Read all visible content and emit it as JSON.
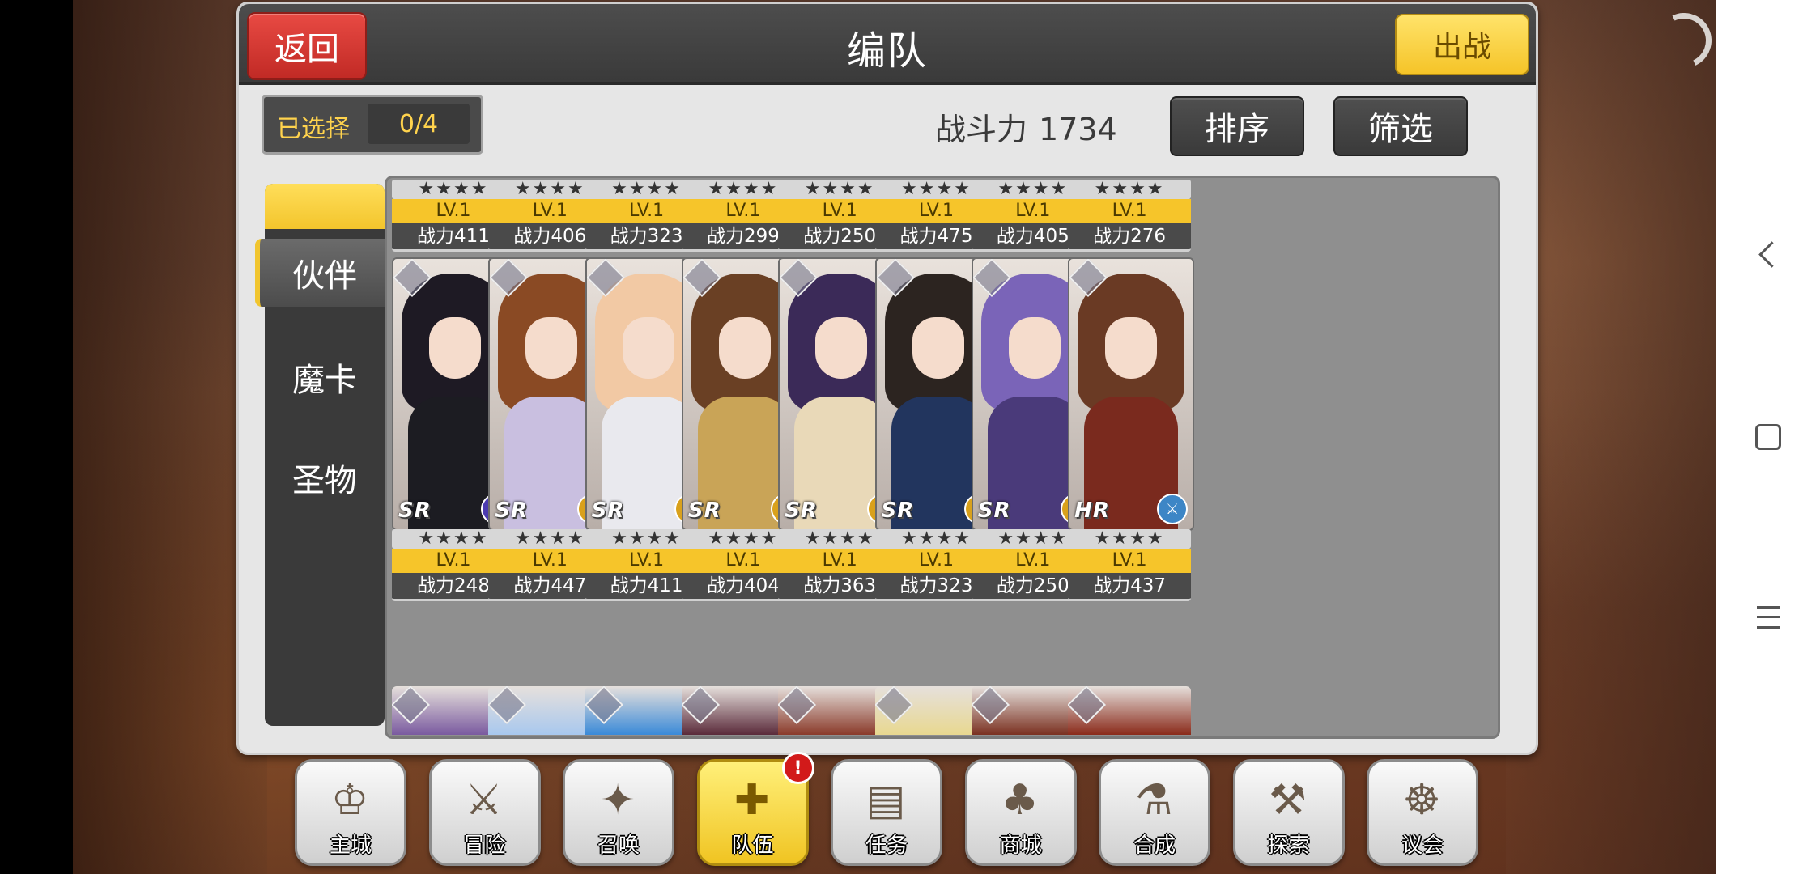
{
  "header": {
    "title": "编队",
    "back_label": "返回",
    "battle_label": "出战"
  },
  "selection": {
    "label": "已选择",
    "value": "0/4"
  },
  "power": {
    "label": "战斗力",
    "value": "1734"
  },
  "actions": {
    "sort_label": "排序",
    "filter_label": "筛选"
  },
  "tabs": {
    "partner": "伙伴",
    "magic_card": "魔卡",
    "relic": "圣物"
  },
  "top_row": [
    {
      "stars": "★★★★",
      "level": "LV.1",
      "power": "战力411"
    },
    {
      "stars": "★★★★",
      "level": "LV.1",
      "power": "战力406"
    },
    {
      "stars": "★★★★",
      "level": "LV.1",
      "power": "战力323"
    },
    {
      "stars": "★★★★",
      "level": "LV.1",
      "power": "战力299"
    },
    {
      "stars": "★★★★",
      "level": "LV.1",
      "power": "战力250"
    },
    {
      "stars": "★★★★",
      "level": "LV.1",
      "power": "战力475"
    },
    {
      "stars": "★★★★",
      "level": "LV.1",
      "power": "战力405"
    },
    {
      "stars": "★★★★",
      "level": "LV.1",
      "power": "战力276"
    }
  ],
  "mid_row": [
    {
      "rarity": "SR",
      "class_icon": "cross-icon",
      "stars": "★★★★",
      "level": "LV.1",
      "power": "战力248",
      "hair": "#1e1a24",
      "outfit": "#1c1c22",
      "class_color": "#4b3bb0"
    },
    {
      "rarity": "SR",
      "class_icon": "hammer-icon",
      "stars": "★★★★",
      "level": "LV.1",
      "power": "战力447",
      "hair": "#8a4a24",
      "outfit": "#c9bfe0",
      "class_color": "#d9a11c"
    },
    {
      "rarity": "SR",
      "class_icon": "sword-icon",
      "stars": "★★★★",
      "level": "LV.1",
      "power": "战力411",
      "hair": "#f2c9a4",
      "outfit": "#e9e9ee",
      "class_color": "#d9a11c"
    },
    {
      "rarity": "SR",
      "class_icon": "shield-icon",
      "stars": "★★★★",
      "level": "LV.1",
      "power": "战力404",
      "hair": "#6a4024",
      "outfit": "#c9a457",
      "class_color": "#d9a11c"
    },
    {
      "rarity": "SR",
      "class_icon": "hammer-icon",
      "stars": "★★★★",
      "level": "LV.1",
      "power": "战力363",
      "hair": "#3b2a58",
      "outfit": "#e9d9b8",
      "class_color": "#d9a11c"
    },
    {
      "rarity": "SR",
      "class_icon": "sword-icon",
      "stars": "★★★★",
      "level": "LV.1",
      "power": "战力323",
      "hair": "#2c2420",
      "outfit": "#22355e",
      "class_color": "#d9a11c"
    },
    {
      "rarity": "SR",
      "class_icon": "cross-icon",
      "stars": "★★★★",
      "level": "LV.1",
      "power": "战力250",
      "hair": "#7a64b8",
      "outfit": "#4a3a7a",
      "class_color": "#d9a11c"
    },
    {
      "rarity": "HR",
      "class_icon": "sword-icon",
      "stars": "★★★★",
      "level": "LV.1",
      "power": "战力437",
      "hair": "#6a3a24",
      "outfit": "#7a2a1e",
      "class_color": "#3d86c6"
    }
  ],
  "bottom_peek_colors": [
    "#7a5aa0",
    "#a8c8ee",
    "#3a8ad8",
    "#5a2a3a",
    "#8a3a2a",
    "#e8d890",
    "#7a3020",
    "#8a2a1a"
  ],
  "bottom_menu": [
    {
      "label": "主城",
      "icon": "crown-icon",
      "glyph": "♔"
    },
    {
      "label": "冒险",
      "icon": "axe-icon",
      "glyph": "⚔"
    },
    {
      "label": "召唤",
      "icon": "card-icon",
      "glyph": "✦"
    },
    {
      "label": "队伍",
      "icon": "wings-icon",
      "glyph": "✚",
      "badge": "!"
    },
    {
      "label": "任务",
      "icon": "book-icon",
      "glyph": "▤"
    },
    {
      "label": "商城",
      "icon": "tree-icon",
      "glyph": "♣"
    },
    {
      "label": "合成",
      "icon": "potion-icon",
      "glyph": "⚗"
    },
    {
      "label": "探索",
      "icon": "pickaxe-icon",
      "glyph": "⚒"
    },
    {
      "label": "议会",
      "icon": "emblem-icon",
      "glyph": "☸"
    }
  ]
}
